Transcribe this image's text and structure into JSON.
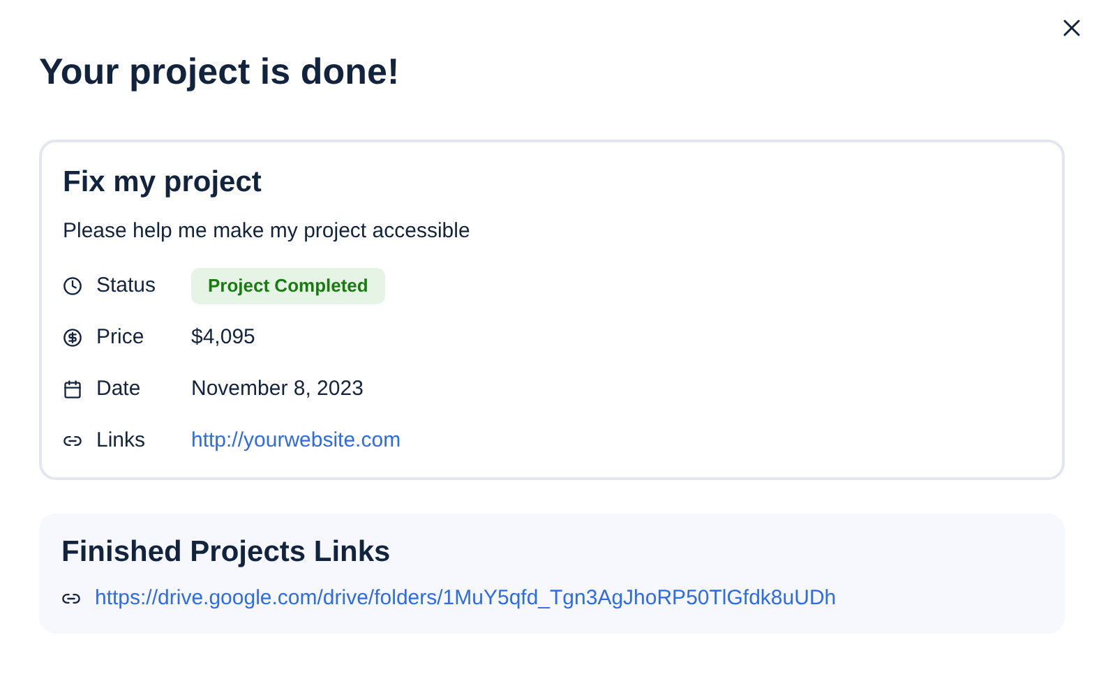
{
  "dialog": {
    "title": "Your project is done!"
  },
  "project": {
    "title": "Fix my project",
    "description": "Please help me make my project accessible",
    "details": [
      {
        "kind": "status",
        "label": "Status",
        "value": "Project Completed"
      },
      {
        "kind": "price",
        "label": "Price",
        "value": "$4,095"
      },
      {
        "kind": "date",
        "label": "Date",
        "value": "November 8, 2023"
      },
      {
        "kind": "links",
        "label": "Links",
        "value": "http://yourwebsite.com"
      }
    ]
  },
  "finished": {
    "title": "Finished Projects Links",
    "link": "https://drive.google.com/drive/folders/1MuY5qfd_Tgn3AgJhoRP50TlGfdk8uUDh"
  }
}
